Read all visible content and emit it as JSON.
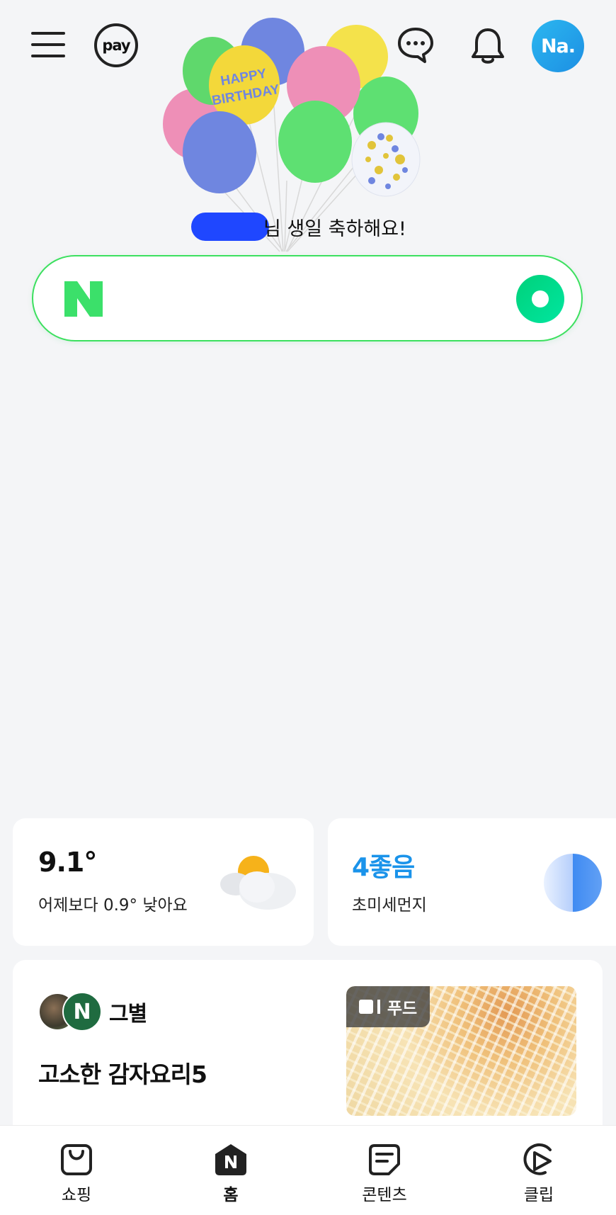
{
  "header": {
    "pay_label": "pay",
    "avatar_text": "Na.",
    "avatar_color": "#1d95e8"
  },
  "birthday": {
    "balloon_text_line1": "HAPPY",
    "balloon_text_line2": "BIRTHDAY",
    "message": "님 생일 축하해요!"
  },
  "search": {
    "logo_letter": "N",
    "placeholder": "",
    "accent_color": "#03c75a"
  },
  "weather": {
    "temperature": "9.1°",
    "comparison": "어제보다 0.9° 낮아요",
    "icon": "partly-cloudy-icon"
  },
  "air_quality": {
    "grade": "4좋음",
    "label": "초미세먼지",
    "grade_color": "#1a93ea"
  },
  "content_card": {
    "source_name": "그별",
    "source_badge_letter": "N",
    "title": "고소한 감자요리5",
    "category_badge": "푸드"
  },
  "bottom_nav": {
    "items": [
      {
        "label": "쇼핑",
        "icon": "shopping-bag-icon"
      },
      {
        "label": "홈",
        "icon": "home-icon"
      },
      {
        "label": "콘텐츠",
        "icon": "content-icon"
      },
      {
        "label": "클립",
        "icon": "clip-play-icon"
      }
    ],
    "active_index": 1
  }
}
